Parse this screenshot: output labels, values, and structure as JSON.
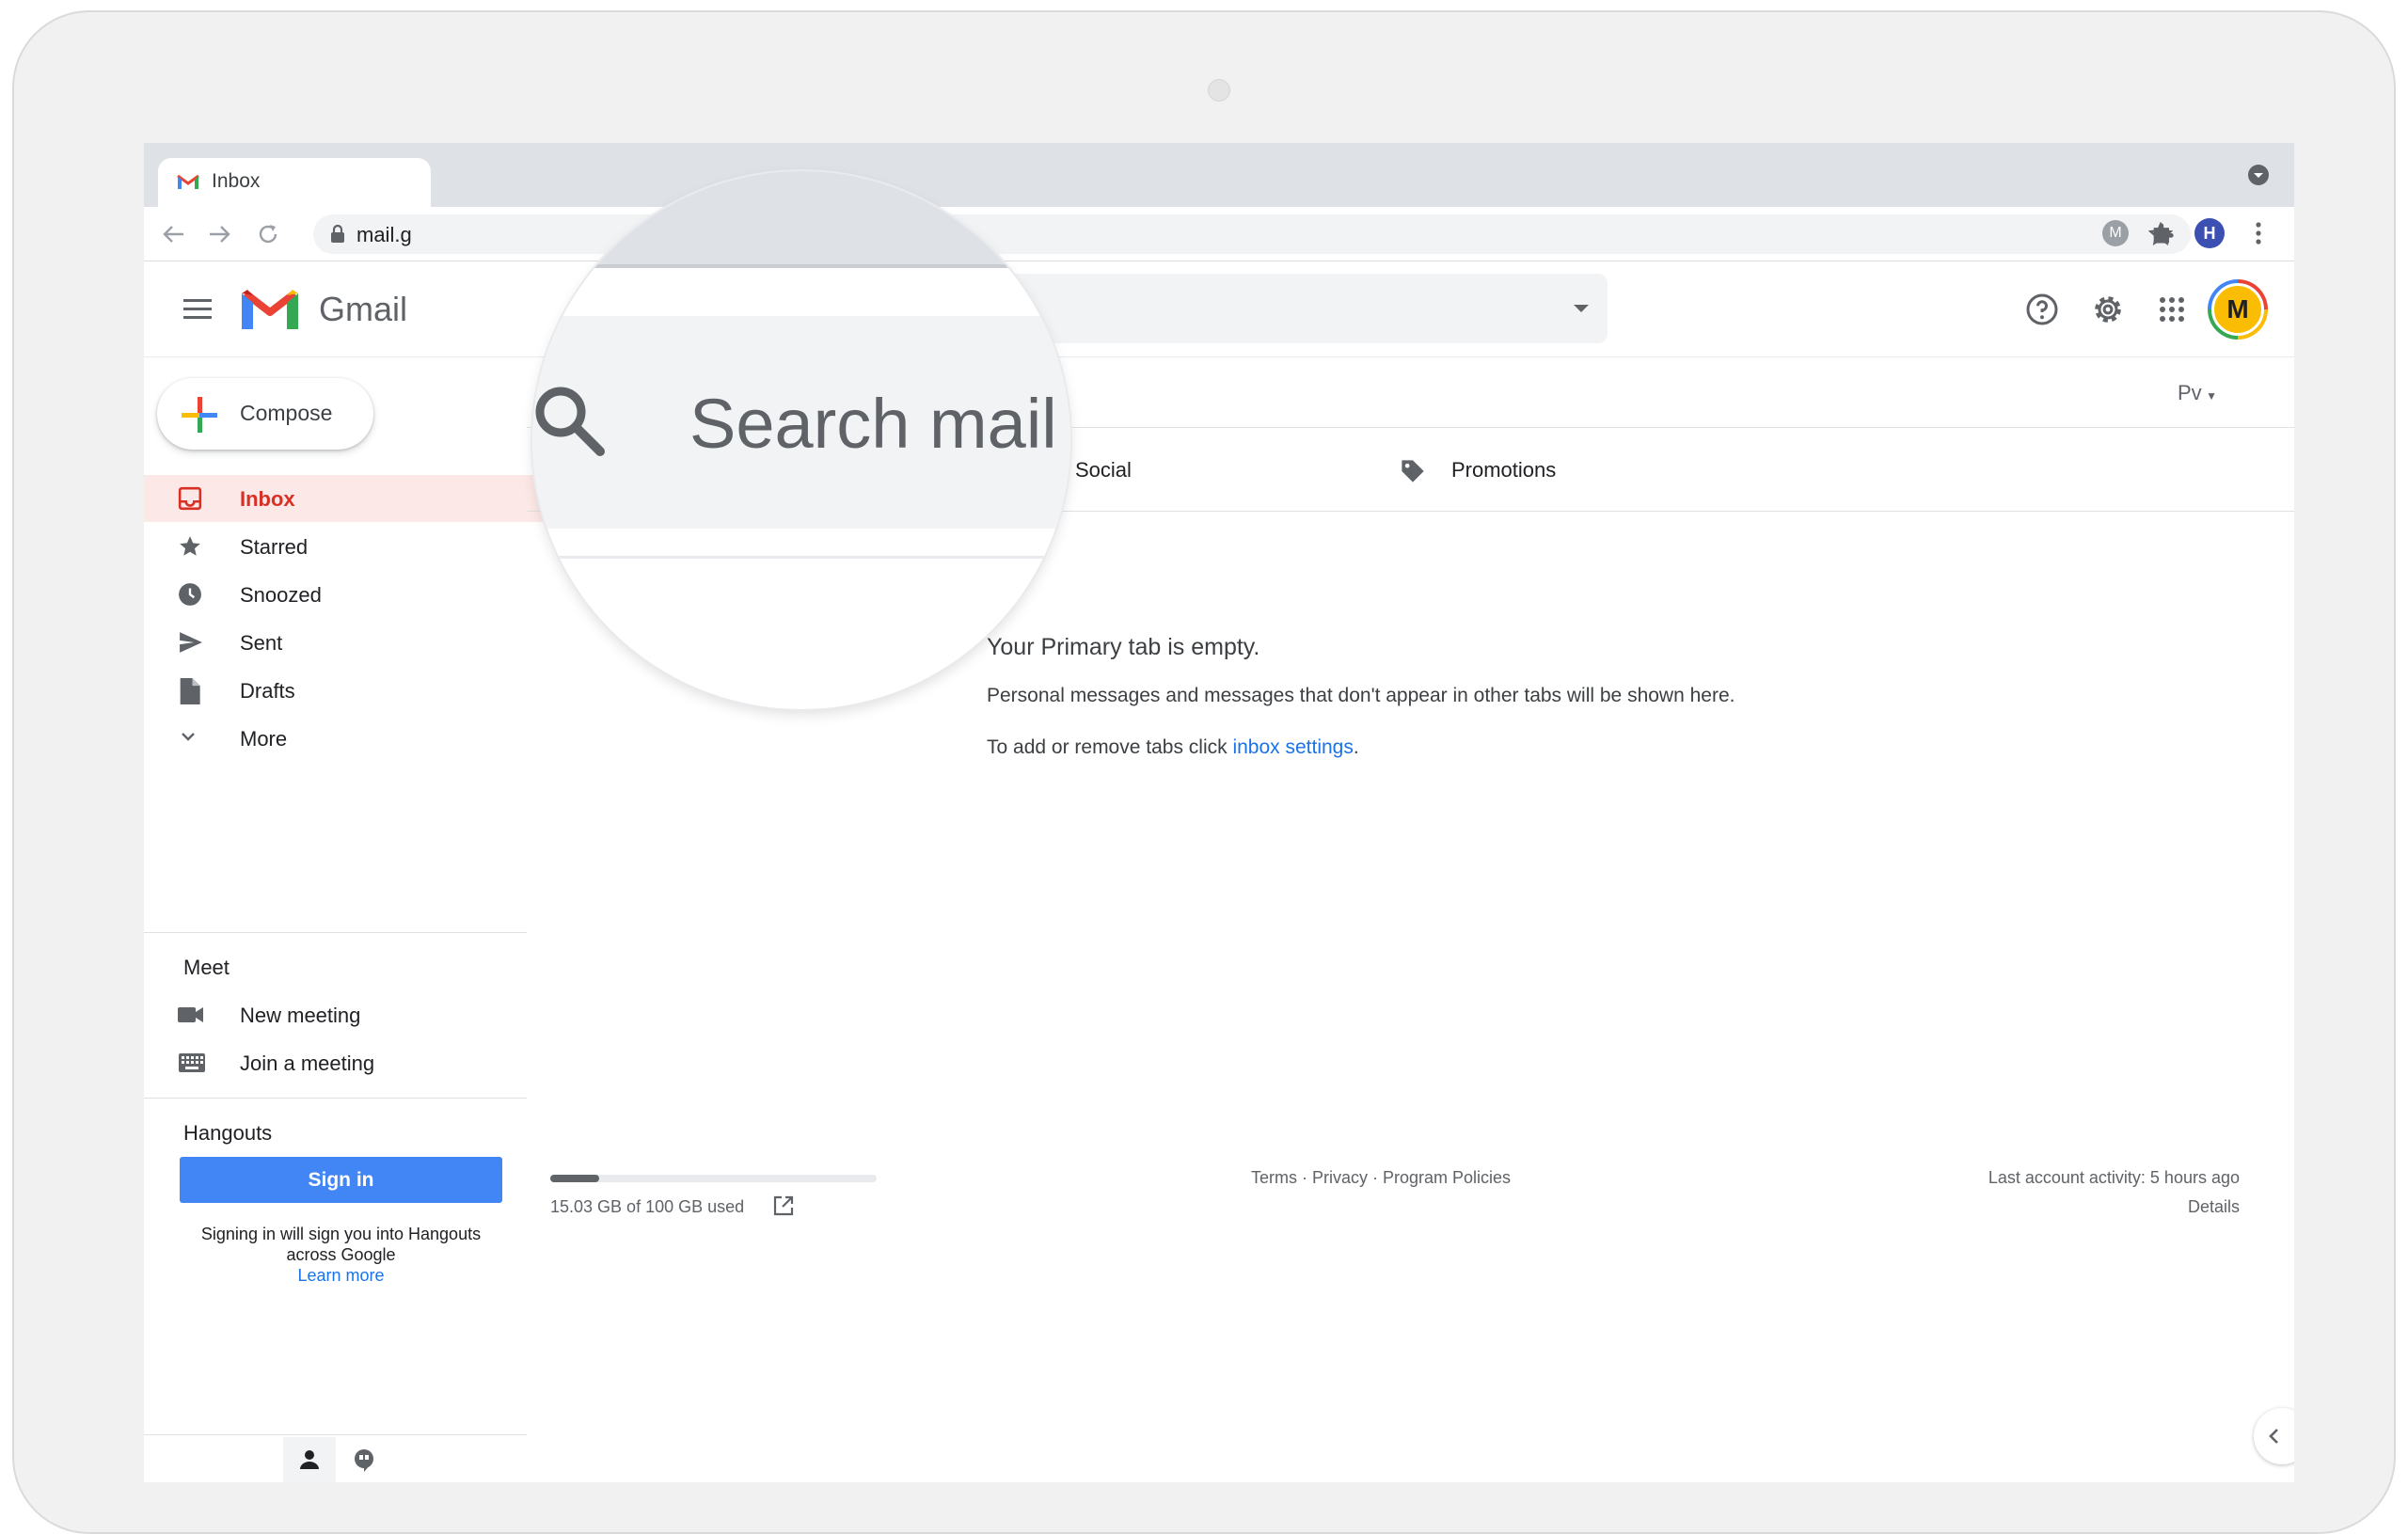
{
  "browser": {
    "tab_title": "Inbox",
    "url_fragment": "mail.g"
  },
  "header": {
    "app_name": "Gmail",
    "search_placeholder": "Search mail",
    "avatar_initial": "M",
    "profile_initial": "H",
    "extension_initial": "M",
    "display_density_label": "Pv"
  },
  "sidebar": {
    "compose_label": "Compose",
    "items": [
      {
        "label": "Inbox",
        "icon": "inbox-icon",
        "active": true
      },
      {
        "label": "Starred",
        "icon": "star-icon"
      },
      {
        "label": "Snoozed",
        "icon": "clock-icon"
      },
      {
        "label": "Sent",
        "icon": "send-icon"
      },
      {
        "label": "Drafts",
        "icon": "draft-icon"
      },
      {
        "label": "More",
        "icon": "chevron-down-icon"
      }
    ],
    "meet": {
      "title": "Meet",
      "new_meeting": "New meeting",
      "join_meeting": "Join a meeting"
    },
    "hangouts": {
      "title": "Hangouts",
      "signin_label": "Sign in",
      "note_line1": "Signing in will sign you into Hangouts",
      "note_line2": "across Google",
      "learn_more": "Learn more"
    }
  },
  "main": {
    "tabs": [
      {
        "label": "Social",
        "icon": "people-icon"
      },
      {
        "label": "Promotions",
        "icon": "tag-icon"
      }
    ],
    "empty": {
      "title": "Your Primary tab is empty.",
      "line1": "Personal messages and messages that don't appear in other tabs will be shown here.",
      "line2_prefix": "To add or remove tabs click ",
      "line2_link": "inbox settings",
      "line2_suffix": "."
    },
    "footer": {
      "storage": "15.03 GB of 100 GB used",
      "storage_fraction": 0.15,
      "links": "Terms · Privacy · Program Policies",
      "last_activity": "Last account activity: 5 hours ago",
      "details": "Details"
    }
  },
  "colors": {
    "accent_red": "#d93025",
    "link_blue": "#1a73e8",
    "signin_blue": "#4285f4",
    "active_bg": "#fce8e6"
  }
}
